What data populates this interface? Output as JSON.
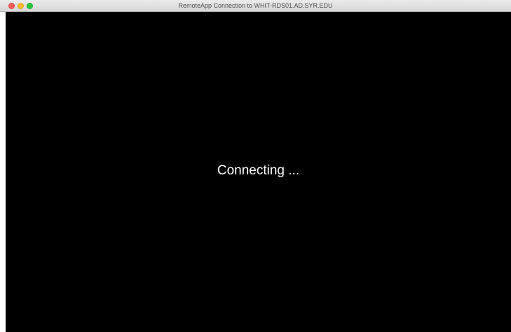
{
  "window": {
    "title": "RemoteApp Connection to WHIT-RDS01.AD.SYR.EDU",
    "controls": {
      "close_icon": "close-icon",
      "minimize_icon": "minimize-icon",
      "zoom_icon": "zoom-icon"
    }
  },
  "content": {
    "status_text": "Connecting ...",
    "background_color": "#000000",
    "text_color": "#ffffff"
  }
}
